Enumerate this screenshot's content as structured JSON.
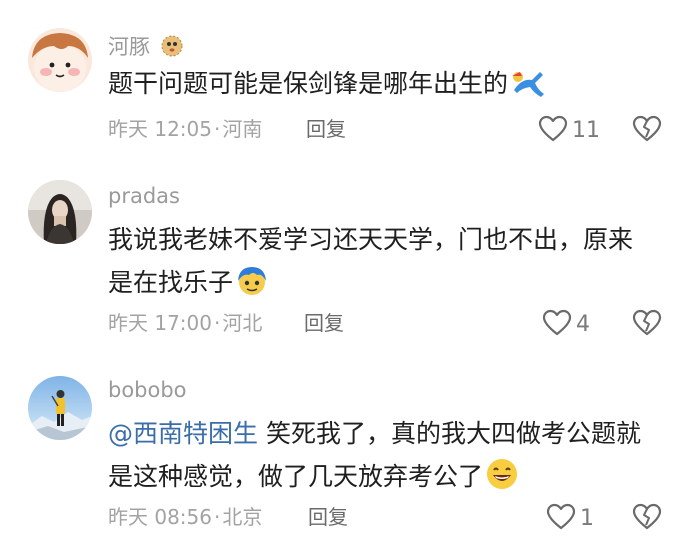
{
  "comments": [
    {
      "username": "河豚",
      "text": "题干问题可能是保剑锋是哪年出生的",
      "time": "昨天 12:05",
      "location": "河南",
      "reply_label": "回复",
      "likes": "11"
    },
    {
      "username": "pradas",
      "text_line1": "我说我老妹不爱学习还天天学，门也不出，原来",
      "text_line2": "是在找乐子",
      "time": "昨天 17:00",
      "location": "河北",
      "reply_label": "回复",
      "likes": "4"
    },
    {
      "username": "bobobo",
      "mention": "@西南特困生",
      "text_line1": " 笑死我了，真的我大四做考公题就",
      "text_line2": "是这种感觉，做了几天放弃考公了",
      "time": "昨天 08:56",
      "location": "北京",
      "reply_label": "回复",
      "likes": "1"
    }
  ],
  "separator": "·",
  "icons": {
    "like": "heart-outline-icon",
    "dislike": "broken-heart-icon",
    "user1_badge": "pufferfish-emoji",
    "emoji1": "jumping-figure-emoji",
    "emoji2": "blue-hair-emoji",
    "emoji3": "grinning-face-emoji"
  }
}
